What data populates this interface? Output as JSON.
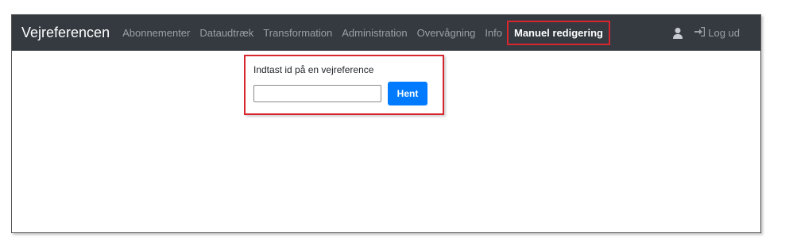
{
  "app": {
    "brand": "Vejreferencen"
  },
  "nav": {
    "items": [
      {
        "label": "Abonnementer"
      },
      {
        "label": "Dataudtræk"
      },
      {
        "label": "Transformation"
      },
      {
        "label": "Administration"
      },
      {
        "label": "Overvågning"
      },
      {
        "label": "Info"
      }
    ],
    "active_item": {
      "label": "Manuel redigering"
    },
    "logout_label": "Log ud",
    "user_icon": "user-icon",
    "logout_icon": "sign-in-arrow-icon"
  },
  "form": {
    "label": "Indtast id på en vejreference",
    "input_value": "",
    "input_placeholder": "",
    "button_label": "Hent"
  },
  "colors": {
    "navbar": "#343a40",
    "highlight": "#d7262e",
    "button": "#007bff"
  }
}
